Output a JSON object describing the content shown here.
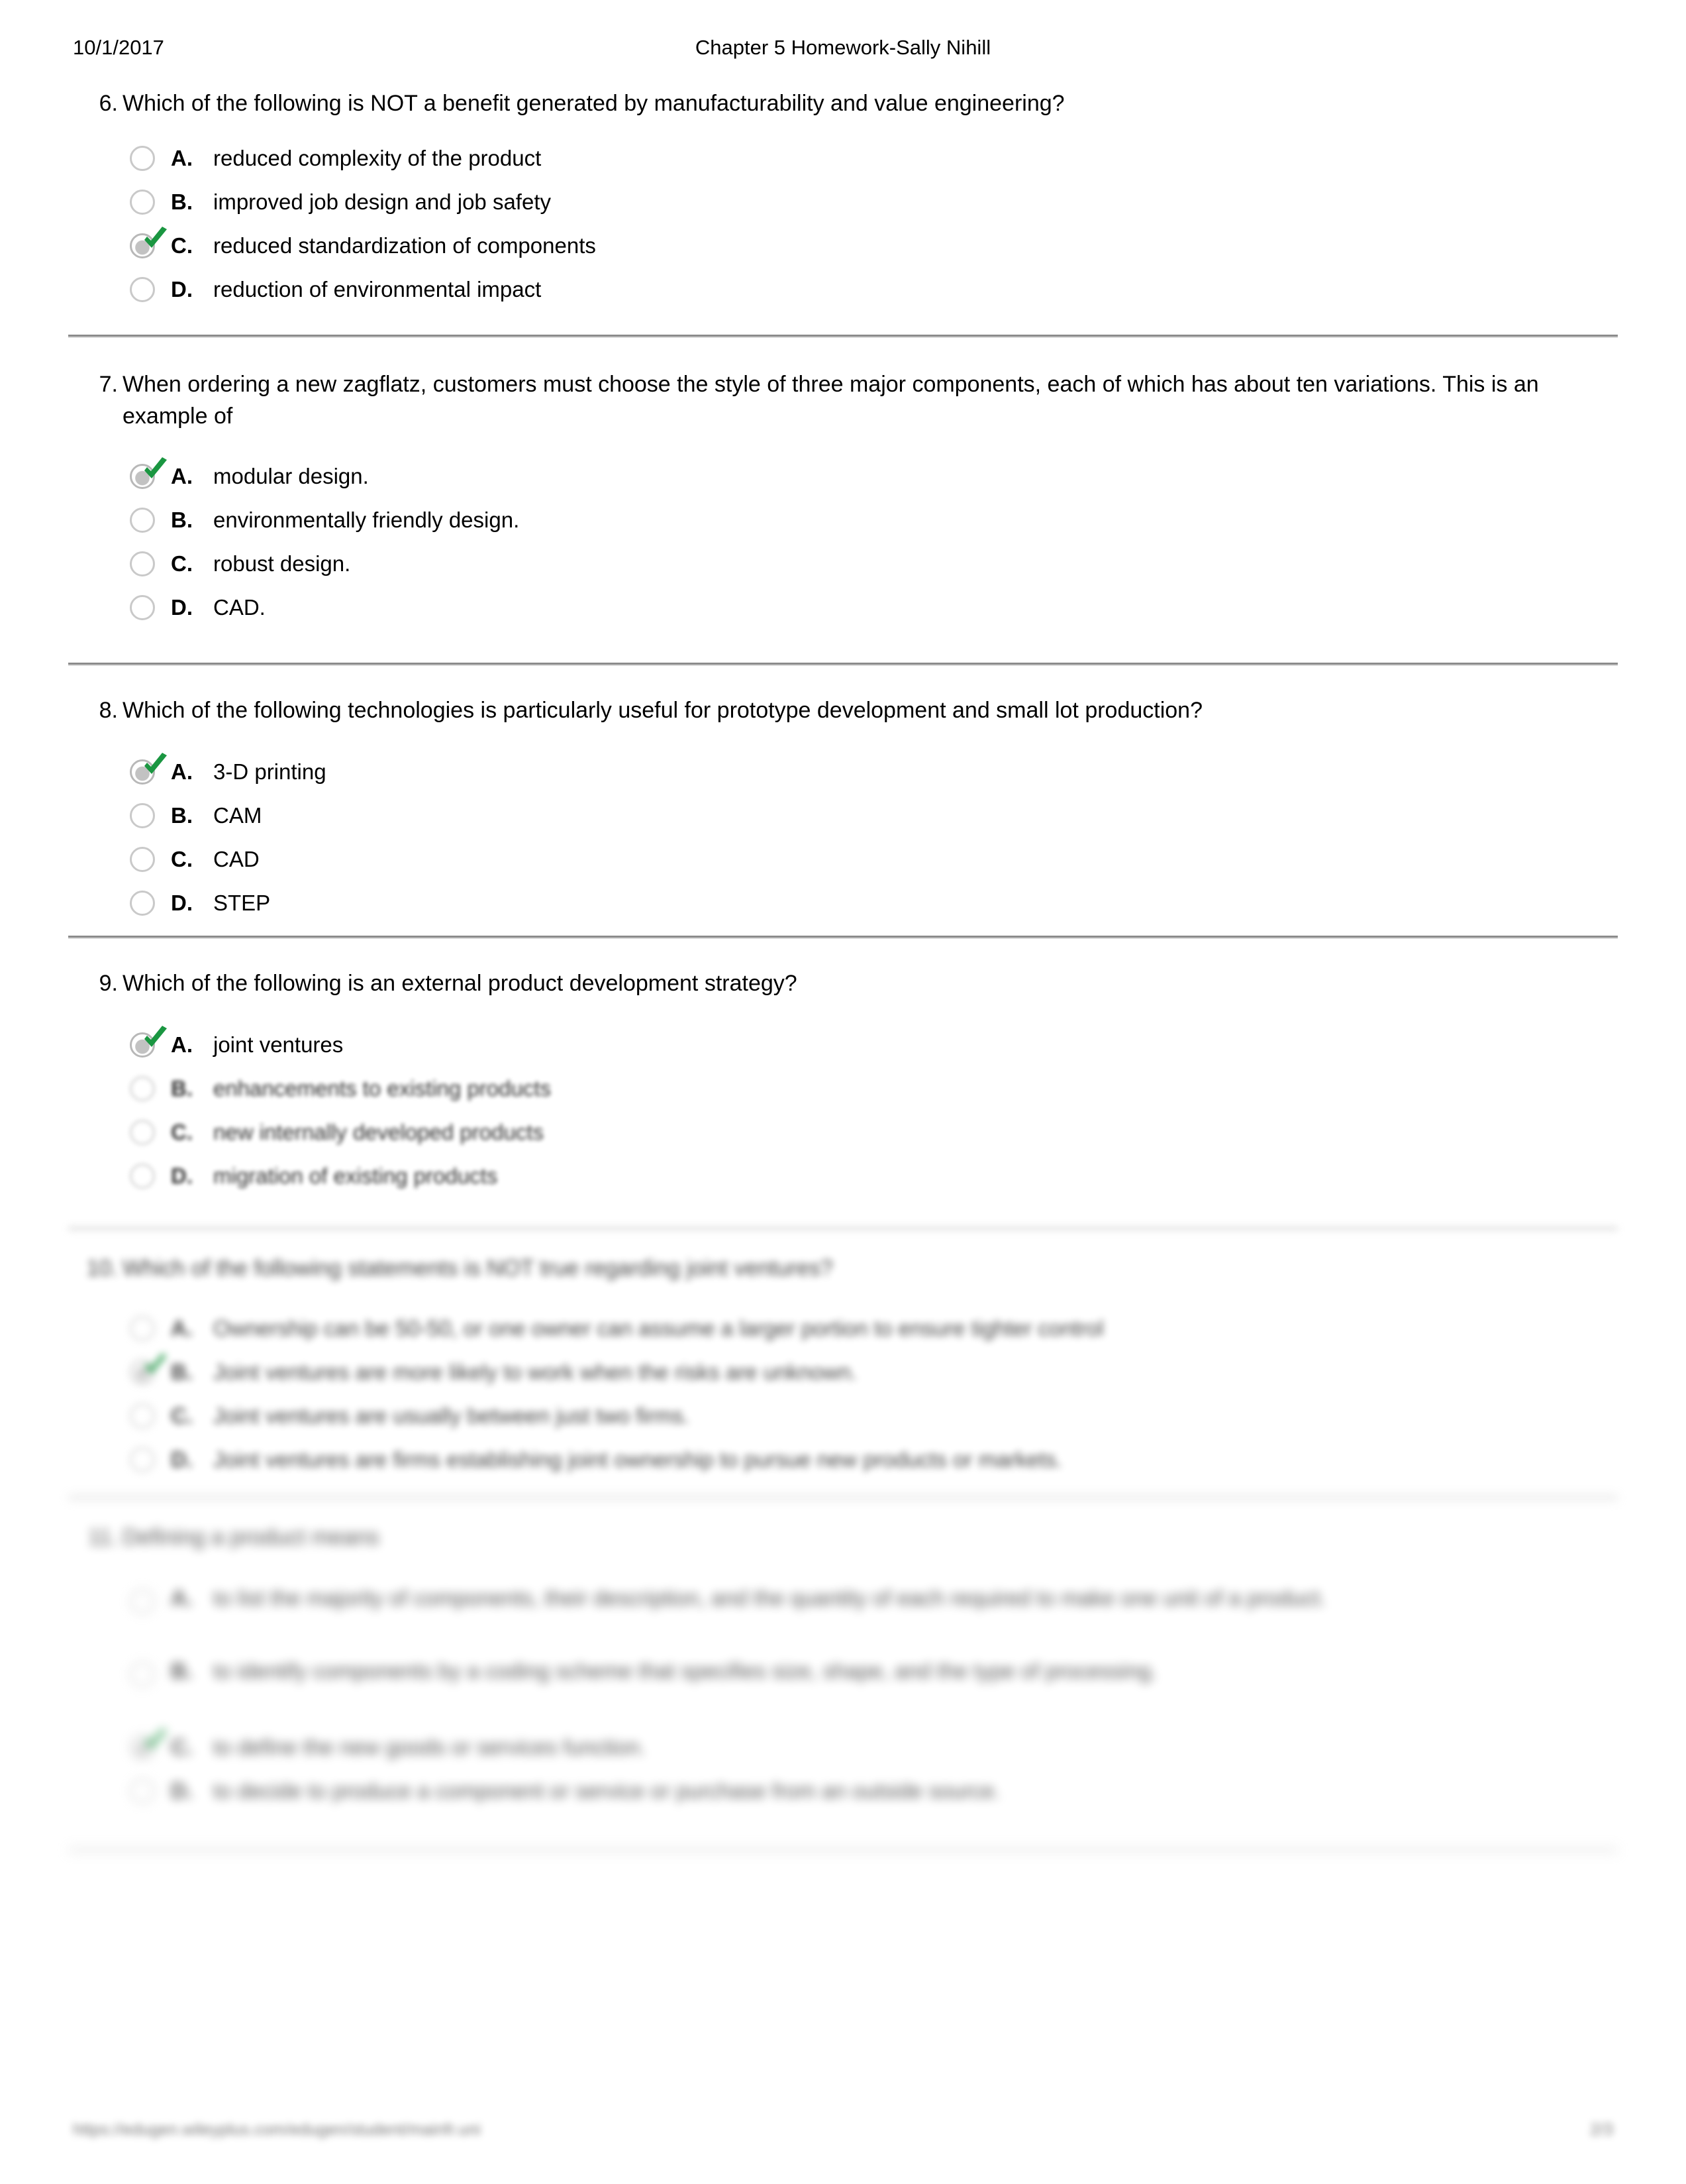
{
  "header": {
    "date": "10/1/2017",
    "title": "Chapter 5 Homework-Sally Nihill"
  },
  "icons": {
    "radio_unselected": "radio-button-unselected-icon",
    "radio_selected": "radio-button-selected-icon",
    "check": "green-check-icon"
  },
  "colors": {
    "check_green": "#1a9641",
    "radio_border": "#c9c9c9",
    "divider": "#8c8c8c",
    "text": "#000000"
  },
  "questions": [
    {
      "number": "6.",
      "text": "Which of the following is NOT a benefit generated by manufacturability and value engineering?",
      "options": [
        {
          "letter": "A.",
          "text": "reduced complexity of the product",
          "selected": false
        },
        {
          "letter": "B.",
          "text": "improved job design and job safety",
          "selected": false
        },
        {
          "letter": "C.",
          "text": "reduced standardization of components",
          "selected": true
        },
        {
          "letter": "D.",
          "text": "reduction of environmental impact",
          "selected": false
        }
      ]
    },
    {
      "number": "7.",
      "text": "When ordering a new zagflatz, customers must choose the style of three major components, each of which has about ten variations. This is an example of",
      "options": [
        {
          "letter": "A.",
          "text": "modular design.",
          "selected": true
        },
        {
          "letter": "B.",
          "text": "environmentally friendly design.",
          "selected": false
        },
        {
          "letter": "C.",
          "text": "robust design.",
          "selected": false
        },
        {
          "letter": "D.",
          "text": "CAD.",
          "selected": false
        }
      ]
    },
    {
      "number": "8.",
      "text": "Which of the following technologies is particularly useful for prototype development and small lot production?",
      "options": [
        {
          "letter": "A.",
          "text": "3-D printing",
          "selected": true
        },
        {
          "letter": "B.",
          "text": "CAM",
          "selected": false
        },
        {
          "letter": "C.",
          "text": "CAD",
          "selected": false
        },
        {
          "letter": "D.",
          "text": "STEP",
          "selected": false
        }
      ]
    },
    {
      "number": "9.",
      "text": "Which of the following is an external product development strategy?",
      "options": [
        {
          "letter": "A.",
          "text": "joint ventures",
          "selected": true,
          "blur": 0
        },
        {
          "letter": "B.",
          "text": "enhancements to existing products",
          "selected": false,
          "blur": 1
        },
        {
          "letter": "C.",
          "text": "new internally developed products",
          "selected": false,
          "blur": 1
        },
        {
          "letter": "D.",
          "text": "migration of existing products",
          "selected": false,
          "blur": 1
        }
      ]
    },
    {
      "number": "10.",
      "text": "Which of the following statements is NOT true regarding joint ventures?",
      "options": [
        {
          "letter": "A.",
          "text": "Ownership can be 50-50, or one owner can assume a larger portion to ensure tighter control",
          "selected": false,
          "blur": 2
        },
        {
          "letter": "B.",
          "text": "Joint ventures are more likely to work when the risks are unknown.",
          "selected": true,
          "blur": 2
        },
        {
          "letter": "C.",
          "text": "Joint ventures are usually between just two firms.",
          "selected": false,
          "blur": 2
        },
        {
          "letter": "D.",
          "text": "Joint ventures are firms establishing joint ownership to pursue new products or markets.",
          "selected": false,
          "blur": 2
        }
      ]
    },
    {
      "number": "11.",
      "text": "Defining a product means",
      "options": [
        {
          "letter": "A.",
          "text": "to list the majority of components, their description, and the quantity of each required to make one unit of a product.",
          "selected": false,
          "blur": 3
        },
        {
          "letter": "B.",
          "text": "to identify components by a coding scheme that specifies size, shape, and the type of processing.",
          "selected": false,
          "blur": 3
        },
        {
          "letter": "C.",
          "text": "to define the new goods or services function.",
          "selected": true,
          "blur": 3
        },
        {
          "letter": "D.",
          "text": "to decide to produce a component or service or purchase from an outside source.",
          "selected": false,
          "blur": 3
        }
      ]
    }
  ],
  "footer": {
    "url": "https://edugen.wileyplus.com/edugen/student/mainfr.uni",
    "page": "2/3"
  }
}
